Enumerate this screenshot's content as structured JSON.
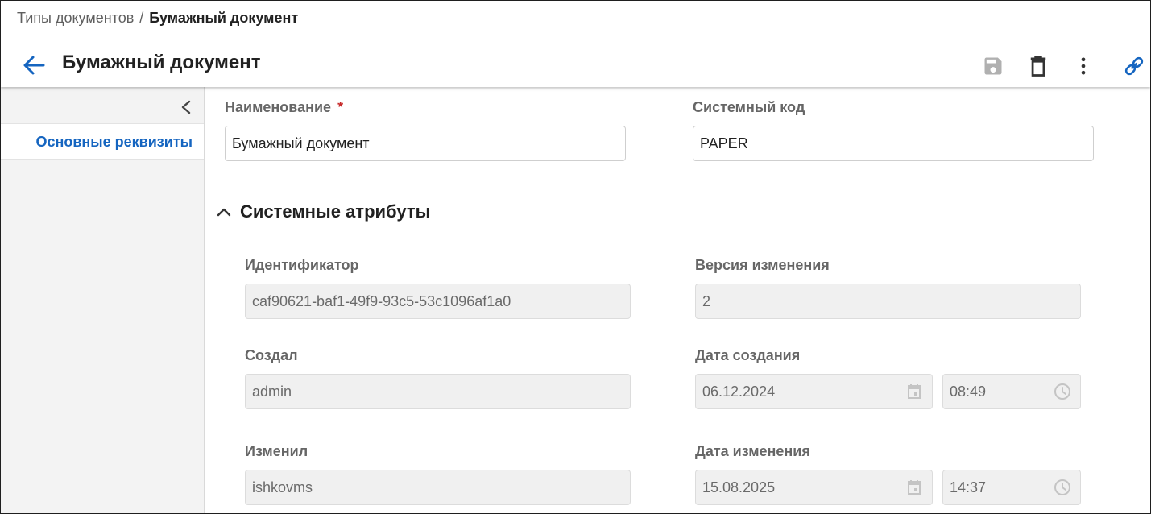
{
  "breadcrumb": {
    "parent": "Типы документов",
    "separator": "/",
    "current": "Бумажный документ"
  },
  "header": {
    "title": "Бумажный документ"
  },
  "toolbar": {
    "icons": [
      "save-icon",
      "delete-icon",
      "more-vert-icon",
      "link-icon"
    ],
    "accent": "#1565c0"
  },
  "sidebar": {
    "items": [
      {
        "label": "Основные реквизиты",
        "active": true
      }
    ]
  },
  "form": {
    "name": {
      "label": "Наименование",
      "required_mark": "*",
      "value": "Бумажный документ"
    },
    "code": {
      "label": "Системный код",
      "value": "PAPER"
    }
  },
  "system_section": {
    "title": "Системные атрибуты",
    "expanded": true,
    "id": {
      "label": "Идентификатор",
      "value": "caf90621-baf1-49f9-93c5-53c1096af1a0"
    },
    "version": {
      "label": "Версия изменения",
      "value": "2"
    },
    "created_by": {
      "label": "Создал",
      "value": "admin"
    },
    "created_at": {
      "label": "Дата создания",
      "date": "06.12.2024",
      "time": "08:49"
    },
    "modified_by": {
      "label": "Изменил",
      "value": "ishkovms"
    },
    "modified_at": {
      "label": "Дата изменения",
      "date": "15.08.2025",
      "time": "14:37"
    }
  }
}
